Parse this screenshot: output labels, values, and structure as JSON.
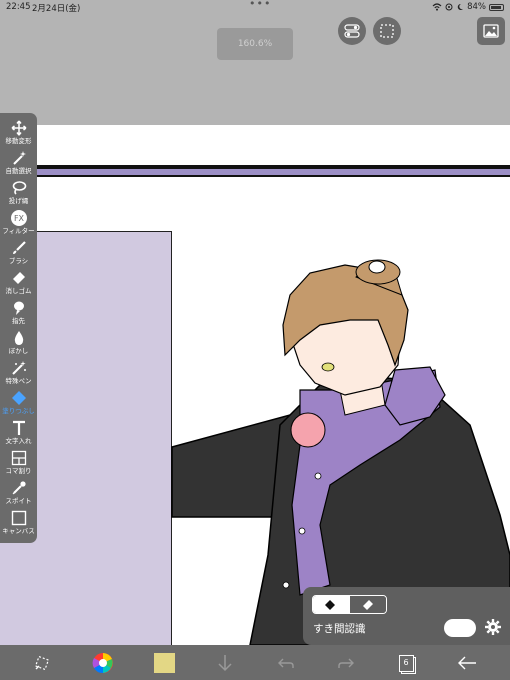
{
  "status_bar": {
    "time": "22:45",
    "date": "2月24日(金)",
    "more": "•••",
    "battery": "84%"
  },
  "top": {
    "zoom": "160.6%"
  },
  "toolbar": {
    "tools": [
      {
        "label": "移動変形",
        "icon": "move-icon",
        "active": false
      },
      {
        "label": "自動選択",
        "icon": "magic-wand-icon",
        "active": false
      },
      {
        "label": "投げ縄",
        "icon": "lasso-icon",
        "active": false
      },
      {
        "label": "フィルター",
        "icon": "fx-icon",
        "active": false
      },
      {
        "label": "ブラシ",
        "icon": "brush-icon",
        "active": false
      },
      {
        "label": "消しゴム",
        "icon": "eraser-icon",
        "active": false
      },
      {
        "label": "指先",
        "icon": "finger-icon",
        "active": false
      },
      {
        "label": "ぼかし",
        "icon": "blur-drop-icon",
        "active": false
      },
      {
        "label": "特殊ペン",
        "icon": "special-pen-icon",
        "active": false
      },
      {
        "label": "塗りつぶし",
        "icon": "fill-bucket-icon",
        "active": true
      },
      {
        "label": "文字入れ",
        "icon": "text-icon",
        "active": false
      },
      {
        "label": "コマ割り",
        "icon": "panel-divide-icon",
        "active": false
      },
      {
        "label": "スポイト",
        "icon": "eyedropper-icon",
        "active": false
      },
      {
        "label": "キャンバス",
        "icon": "canvas-icon",
        "active": false
      }
    ]
  },
  "fill_panel": {
    "gap_label": "すき間認識",
    "gap_enabled": true
  },
  "bottom_bar": {
    "layer_count": "6",
    "primary_color": "#e3d785"
  },
  "colors": {
    "accent": "#4aa3ff",
    "band": "#9c8fc6",
    "lavender": "#d1c9e0"
  }
}
